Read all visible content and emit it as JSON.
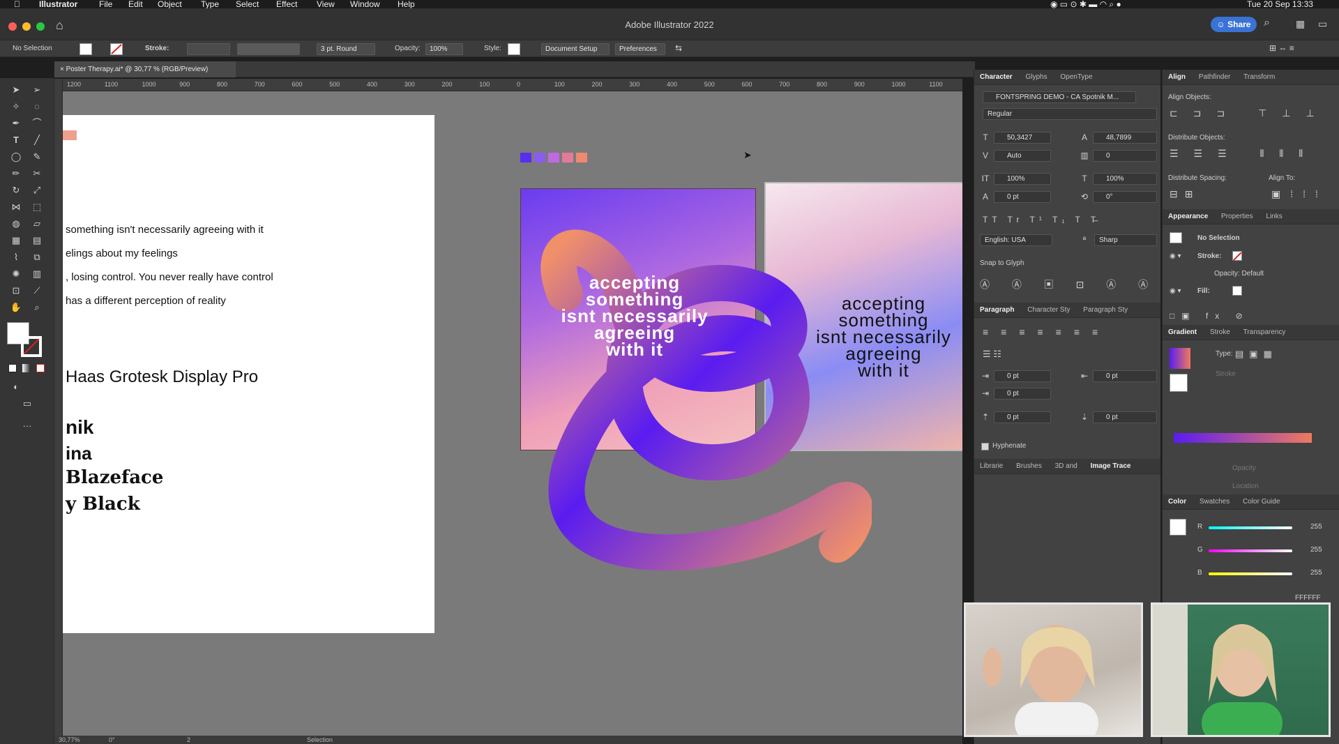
{
  "menubar": {
    "app": "Illustrator",
    "items": [
      "File",
      "Edit",
      "Object",
      "Type",
      "Select",
      "Effect",
      "View",
      "Window",
      "Help"
    ],
    "clock": "Tue 20 Sep  13:33"
  },
  "titlebar": {
    "title": "Adobe Illustrator 2022",
    "share_label": "Share"
  },
  "control": {
    "selection": "No Selection",
    "stroke_label": "Stroke:",
    "brush": "3 pt. Round",
    "opacity_label": "Opacity:",
    "opacity_value": "100%",
    "style_label": "Style:",
    "doc_setup": "Document Setup",
    "preferences": "Preferences"
  },
  "document": {
    "tab_title": "Poster Therapy.ai* @ 30,77 % (RGB/Preview)"
  },
  "ruler": {
    "ticks": [
      "1200",
      "1100",
      "1000",
      "900",
      "800",
      "700",
      "600",
      "500",
      "400",
      "300",
      "200",
      "100",
      "0",
      "100",
      "200",
      "300",
      "400",
      "500",
      "600",
      "700",
      "800",
      "900",
      "1000",
      "1100"
    ]
  },
  "artboard": {
    "lines": [
      "something isn't necessarily agreeing with it",
      "elings about my feelings",
      ", losing control. You never really have control",
      "has a different perception of reality"
    ],
    "fonts": [
      "Haas Grotesk Display Pro",
      "nik",
      "ina",
      "Blazeface",
      "y Black"
    ]
  },
  "poster": {
    "text_1": [
      "accepting",
      "something",
      "isnt necessarily",
      "agreeing",
      "with it"
    ],
    "text_2": [
      "accepting",
      "something",
      "isnt necessarily",
      "agreeing",
      "with it"
    ]
  },
  "statusbar": {
    "zoom": "30,77%",
    "rotation": "0°",
    "artboard": "2",
    "mode": "Selection"
  },
  "character_panel": {
    "tabs": [
      "Character",
      "Glyphs",
      "OpenType"
    ],
    "font": "FONTSPRING DEMO - CA Spotnik M...",
    "style": "Regular",
    "size": "50,3427",
    "leading": "48,7899",
    "kerning": "Auto",
    "tracking": "0",
    "vscale": "100%",
    "hscale": "100%",
    "baseline": "0 pt",
    "rotation": "0°",
    "language": "English: USA",
    "aa": "Sharp",
    "snap_label": "Snap to Glyph"
  },
  "paragraph_panel": {
    "tabs": [
      "Paragraph",
      "Character Sty",
      "Paragraph Sty"
    ],
    "indent_left": "0 pt",
    "indent_right": "0 pt",
    "first_line": "0 pt",
    "space_before": "0 pt",
    "space_after": "0 pt",
    "hyphenate": "Hyphenate"
  },
  "lib_tabs": [
    "Librarie",
    "Brushes",
    "3D and",
    "Image Trace"
  ],
  "align_panel": {
    "tabs": [
      "Align",
      "Pathfinder",
      "Transform"
    ],
    "align_objects": "Align Objects:",
    "distribute_objects": "Distribute Objects:",
    "distribute_spacing": "Distribute Spacing:",
    "align_to": "Align To:"
  },
  "appearance_panel": {
    "tabs": [
      "Appearance",
      "Properties",
      "Links"
    ],
    "selection": "No Selection",
    "stroke": "Stroke:",
    "opacity": "Opacity: Default",
    "fill": "Fill:"
  },
  "gradient_panel": {
    "tabs": [
      "Gradient",
      "Stroke",
      "Transparency"
    ],
    "type_label": "Type:",
    "stroke_label": "Stroke",
    "opacity_label": "Opacity",
    "location_label": "Location"
  },
  "color_panel": {
    "tabs": [
      "Color",
      "Swatches",
      "Color Guide"
    ],
    "r_label": "R",
    "r_value": "255",
    "g_label": "G",
    "g_value": "255",
    "b_label": "B",
    "b_value": "255",
    "hex": "FFFFFF"
  },
  "colors": {
    "accent": "#3a73d6",
    "gradient_start": "#5a1cf0",
    "gradient_end": "#f07a5e"
  }
}
